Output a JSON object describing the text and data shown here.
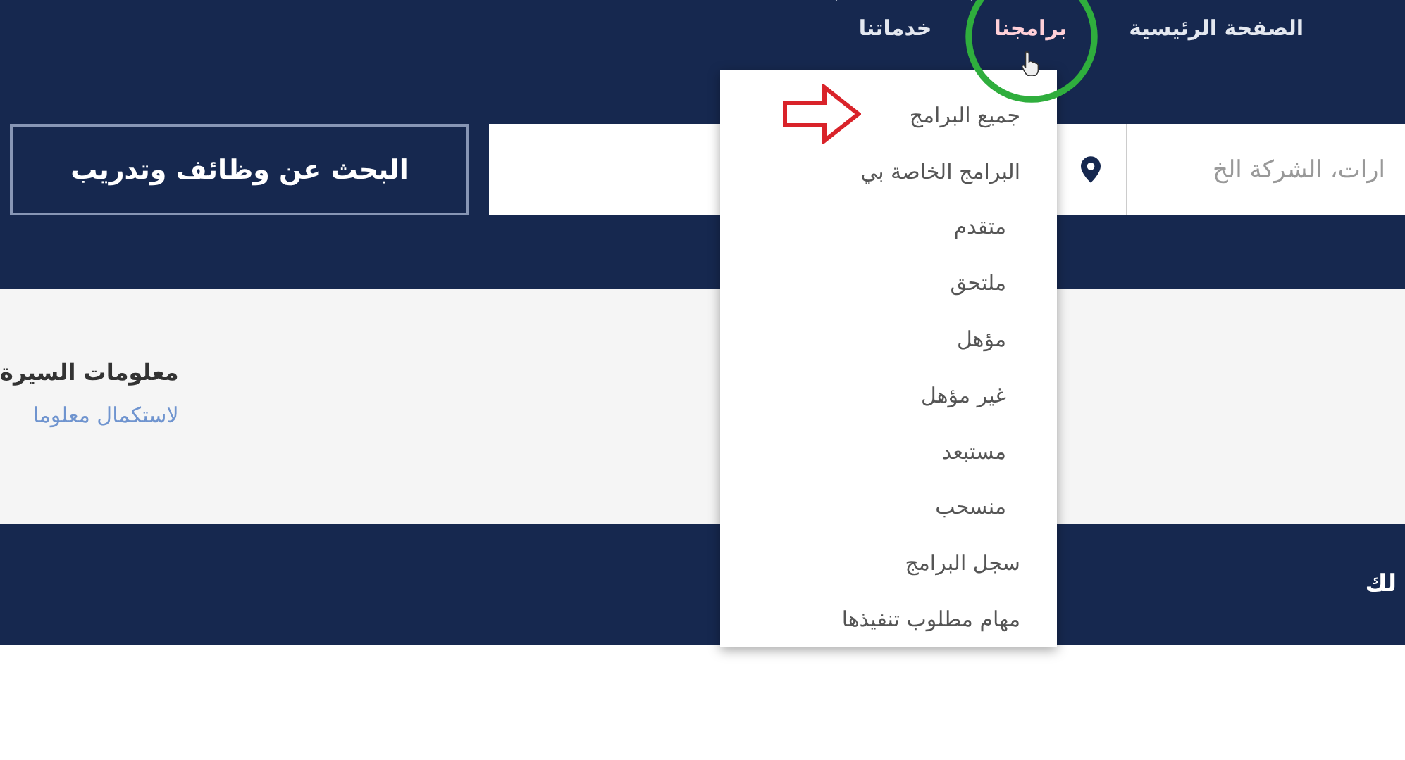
{
  "nav": {
    "items": [
      {
        "label": "الصفحة الرئيسية",
        "has_menu": false,
        "selected": false
      },
      {
        "label": "برامجنا",
        "has_menu": true,
        "selected": true
      },
      {
        "label": "خدماتنا",
        "has_menu": true,
        "selected": false
      }
    ]
  },
  "search": {
    "keyword_placeholder": "ارات، الشركة الخ",
    "button": "البحث عن وظائف وتدريب"
  },
  "programs_menu": {
    "items": [
      {
        "label": "جميع البرامج",
        "highlighted": true
      },
      {
        "label": "البرامج الخاصة بي",
        "highlighted": false
      },
      {
        "label": "متقدم",
        "highlighted": false
      },
      {
        "label": "ملتحق",
        "highlighted": false
      },
      {
        "label": "مؤهل",
        "highlighted": false
      },
      {
        "label": "غير مؤهل",
        "highlighted": false
      },
      {
        "label": "مستبعد",
        "highlighted": false
      },
      {
        "label": "منسحب",
        "highlighted": false
      },
      {
        "label": "سجل البرامج",
        "highlighted": false
      },
      {
        "label": "مهام مطلوب تنفيذها",
        "highlighted": false
      }
    ]
  },
  "profile": {
    "title": "معلومات السيرة",
    "link": "لاستكمال معلوما"
  },
  "band": {
    "text": "لك"
  }
}
